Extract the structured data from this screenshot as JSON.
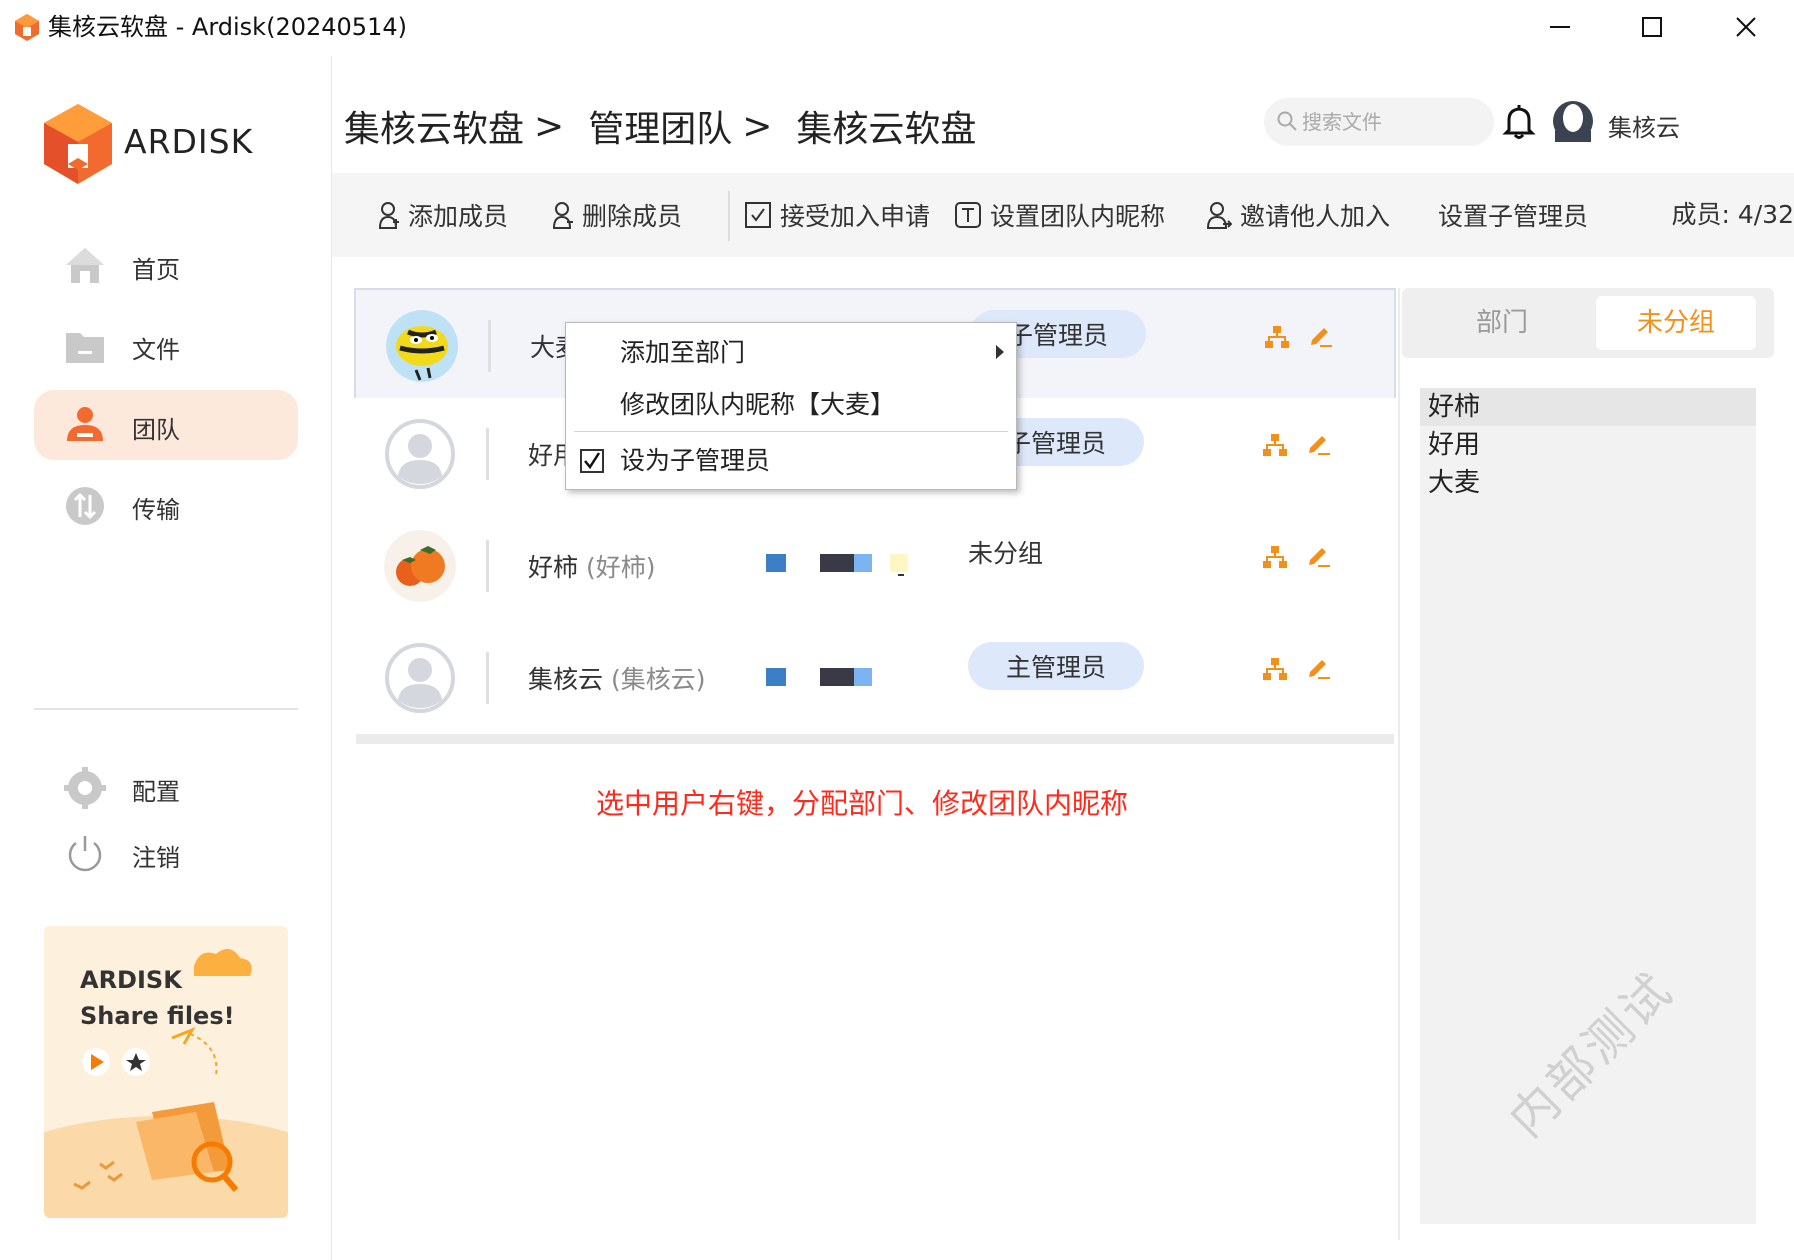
{
  "window": {
    "title": "集核云软盘 - Ardisk(20240514)"
  },
  "sidebar": {
    "logo_text": "ARDISK",
    "nav": [
      {
        "label": "首页",
        "icon": "home-icon"
      },
      {
        "label": "文件",
        "icon": "folder-icon"
      },
      {
        "label": "团队",
        "icon": "team-icon",
        "active": true
      },
      {
        "label": "传输",
        "icon": "transfer-icon"
      }
    ],
    "bottom_nav": [
      {
        "label": "配置",
        "icon": "gear-icon"
      },
      {
        "label": "注销",
        "icon": "power-icon"
      }
    ],
    "promo": {
      "line1": "ARDISK",
      "line2": "Share files!"
    }
  },
  "header": {
    "breadcrumbs": [
      "集核云软盘",
      "管理团队",
      "集核云软盘"
    ],
    "breadcrumb_separator": ">",
    "search_placeholder": "搜索文件",
    "user_name": "集核云"
  },
  "toolbar": {
    "add_member": "添加成员",
    "remove_member": "删除成员",
    "accept_requests": "接受加入申请",
    "set_nickname": "设置团队内昵称",
    "invite": "邀请他人加入",
    "set_sub_admin": "设置子管理员",
    "members_count": "成员: 4/32"
  },
  "members": [
    {
      "name": "大麦",
      "nick": "",
      "role": "子管理员",
      "avatar": "bee-avatar",
      "selected": true
    },
    {
      "name": "好用",
      "nick": "",
      "role": "子管理员",
      "avatar": "default-avatar"
    },
    {
      "name": "好柿",
      "nick": "(好柿)",
      "role": "未分组",
      "avatar": "persimmon-avatar"
    },
    {
      "name": "集核云",
      "nick": "(集核云)",
      "role": "主管理员",
      "avatar": "default-avatar"
    }
  ],
  "context_menu": {
    "add_to_dept": "添加至部门",
    "rename": "修改团队内昵称【大麦】",
    "set_sub_admin": "设为子管理员"
  },
  "hint": "选中用户右键，分配部门、修改团队内昵称",
  "right_panel": {
    "tab_dept": "部门",
    "tab_ungrouped": "未分组",
    "items": [
      "好柿",
      "好用",
      "大麦"
    ]
  },
  "watermark": "内部测试",
  "colors": {
    "accent": "#f39019",
    "active_nav_bg": "#fde9dc",
    "role_pill_bg": "#dde9fb",
    "hint_red": "#ff2a1a"
  }
}
